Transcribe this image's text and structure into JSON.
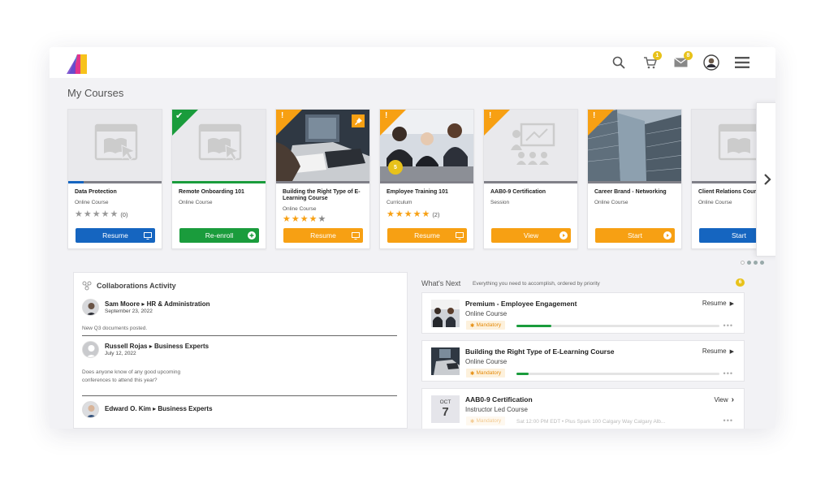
{
  "header": {
    "cart_badge": "1",
    "mail_badge": "8"
  },
  "my_courses": {
    "title": "My Courses",
    "cards": [
      {
        "title": "Data Protection",
        "type": "Online Course",
        "rating": 0,
        "rating_count": "(0)",
        "button": "Resume",
        "progress": 0.16,
        "button_color": "#1565c0",
        "progress_color": "#1565c0"
      },
      {
        "title": "Remote Onboarding 101",
        "type": "Online Course",
        "button": "Re-enroll",
        "progress": 1.0,
        "button_color": "#1a9c3c",
        "progress_color": "#1a9c3c"
      },
      {
        "title": "Building the Right Type of E-Learning Course",
        "type": "Online Course",
        "rating": 4,
        "button": "Resume",
        "progress": 0.0,
        "button_color": "#f7a013"
      },
      {
        "title": "Employee Training 101",
        "type": "Curriculum",
        "rating": 5,
        "rating_count": "(2)",
        "button": "Resume",
        "progress": 0.0,
        "button_color": "#f7a013",
        "badge": "5"
      },
      {
        "title": "AAB0-9 Certification",
        "type": "Session",
        "button": "View",
        "progress": 0.0,
        "button_color": "#f7a013"
      },
      {
        "title": "Career Brand - Networking",
        "type": "Online Course",
        "button": "Start",
        "progress": 0.0,
        "button_color": "#f7a013"
      },
      {
        "title": "Client Relations Course",
        "type": "Online Course",
        "button": "Start",
        "progress": 0.0,
        "button_color": "#1565c0"
      }
    ]
  },
  "collaborations": {
    "title": "Collaborations Activity",
    "posts": [
      {
        "name": "Sam Moore",
        "group": "HR & Administration",
        "date": "September 23, 2022",
        "text": "New Q3 documents posted."
      },
      {
        "name": "Russell Rojas",
        "group": "Business Experts",
        "date": "July 12, 2022",
        "text": "Does anyone know of any good upcoming conferences to attend this year?"
      },
      {
        "name": "Edward O. Kim",
        "group": "Business Experts"
      }
    ]
  },
  "whats_next": {
    "title": "What's Next",
    "subtitle": "Everything you need to accomplish, ordered by priority",
    "count": "6",
    "items": [
      {
        "name": "Premium - Employee Engagement",
        "type": "Online Course",
        "tag": "Mandatory",
        "action": "Resume",
        "progress": 0.17
      },
      {
        "name": "Building the Right Type of E-Learning Course",
        "type": "Online Course",
        "tag": "Mandatory",
        "action": "Resume",
        "progress": 0.06
      },
      {
        "name": "AAB0-9 Certification",
        "type": "Instructor Led Course",
        "tag": "Mandatory",
        "action": "View",
        "month": "OCT",
        "day": "7",
        "details": "Sat 12:00 PM EDT  •  Plus Spark 100 Calgary Way Calgary Alb..."
      }
    ]
  },
  "colors": {
    "accent": "#f7a013",
    "blue": "#1565c0",
    "green": "#1a9c3c",
    "badge": "#e8c21a"
  }
}
